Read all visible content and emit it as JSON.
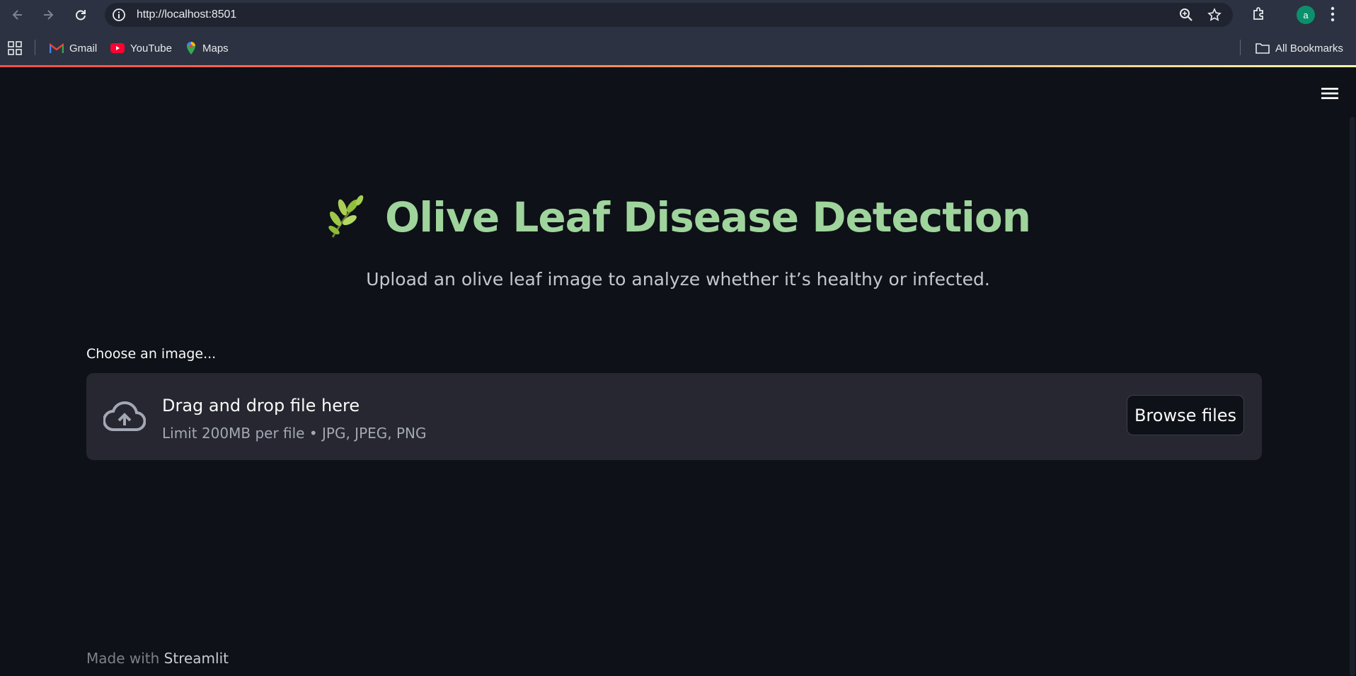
{
  "browser": {
    "url": "http://localhost:8501",
    "profile_initial": "a",
    "bookmarks": [
      {
        "label": "Gmail",
        "icon": "gmail-icon"
      },
      {
        "label": "YouTube",
        "icon": "youtube-icon"
      },
      {
        "label": "Maps",
        "icon": "maps-icon"
      }
    ],
    "all_bookmarks_label": "All Bookmarks"
  },
  "app": {
    "title_icon": "🌿",
    "title": "Olive Leaf Disease Detection",
    "subtitle": "Upload an olive leaf image to analyze whether it’s healthy or infected.",
    "uploader": {
      "label": "Choose an image...",
      "drop_title": "Drag and drop file here",
      "limit_text": "Limit 200MB per file • JPG, JPEG, PNG",
      "browse_label": "Browse files"
    },
    "footer": {
      "prefix": "Made with",
      "brand": "Streamlit"
    }
  },
  "colors": {
    "background": "#0e1117",
    "title": "#9fd49c",
    "dropzone": "#262730",
    "chrome": "#2c3241"
  }
}
